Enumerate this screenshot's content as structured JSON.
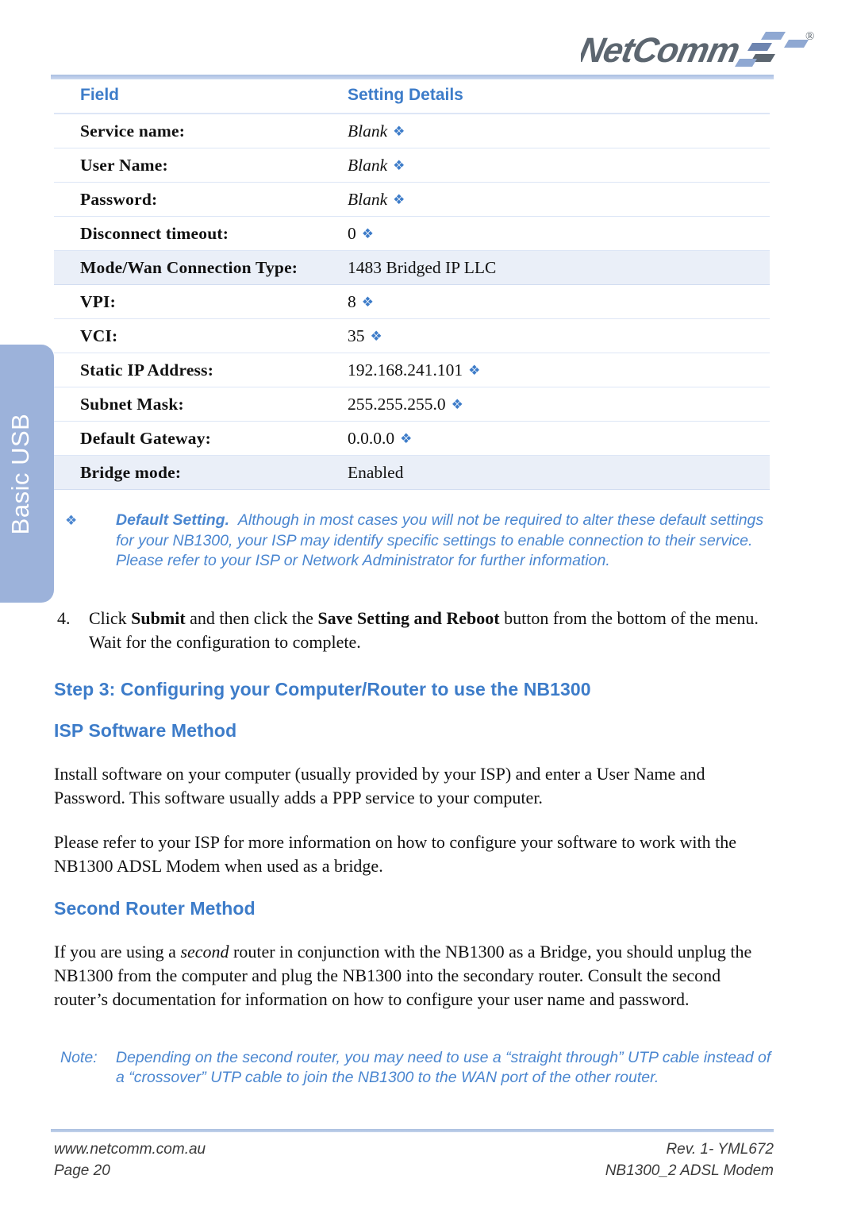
{
  "brand": {
    "logo_text": "NetComm",
    "registered_mark": "®"
  },
  "side_tab": {
    "label": "Basic USB"
  },
  "table": {
    "headers": {
      "field": "Field",
      "value": "Setting Details"
    },
    "rows": [
      {
        "field": "Service name:",
        "value": "Blank",
        "italic": true,
        "bullet": true,
        "shaded": false
      },
      {
        "field": "User Name:",
        "value": "Blank",
        "italic": true,
        "bullet": true,
        "shaded": false
      },
      {
        "field": "Password:",
        "value": "Blank",
        "italic": true,
        "bullet": true,
        "shaded": false
      },
      {
        "field": "Disconnect timeout:",
        "value": "0",
        "italic": false,
        "bullet": true,
        "shaded": false
      },
      {
        "field": "Mode/Wan Connection Type:",
        "value": "1483 Bridged IP LLC",
        "italic": false,
        "bullet": false,
        "shaded": true
      },
      {
        "field": "VPI:",
        "value": "8",
        "italic": false,
        "bullet": true,
        "shaded": false
      },
      {
        "field": "VCI:",
        "value": "35",
        "italic": false,
        "bullet": true,
        "shaded": false
      },
      {
        "field": "Static IP Address:",
        "value": "192.168.241.101",
        "italic": false,
        "bullet": true,
        "shaded": false
      },
      {
        "field": "Subnet Mask:",
        "value": "255.255.255.0",
        "italic": false,
        "bullet": true,
        "shaded": false
      },
      {
        "field": "Default Gateway:",
        "value": "0.0.0.0",
        "italic": false,
        "bullet": true,
        "shaded": false
      },
      {
        "field": "Bridge mode:",
        "value": "Enabled",
        "italic": false,
        "bullet": false,
        "shaded": true
      }
    ]
  },
  "default_setting_note": {
    "marker": "❖",
    "lead": "Default Setting.",
    "text": "Although in most cases you will not be required to alter these default settings for your NB1300, your ISP may identify specific settings to enable connection to their service.  Please refer to your ISP or Network Administrator for further information."
  },
  "step4": {
    "number": "4.",
    "part1": "Click ",
    "bold1": "Submit",
    "part2": " and then click the ",
    "bold2": "Save Setting and Reboot",
    "part3": " button from the bottom of the menu. Wait for the configuration to complete."
  },
  "headings": {
    "step3": "Step 3:  Configuring your Computer/Router to use the NB1300",
    "isp_software_method": "ISP Software Method",
    "second_router_method": "Second Router Method"
  },
  "paragraphs": {
    "isp_p1": "Install software on your computer (usually provided by your ISP) and enter a User Name and Password.  This software usually adds a PPP service to your computer.",
    "isp_p2": "Please refer to your ISP for more information on how to configure your software to work with the NB1300 ADSL Modem when used as a bridge.",
    "router_p1_a": "If you are using a ",
    "router_p1_italic": "second",
    "router_p1_b": " router in conjunction with the NB1300 as a Bridge, you should unplug the NB1300 from the computer and plug the NB1300 into the secondary router.  Consult the second router’s documentation for information on how to configure your user name and password."
  },
  "bottom_note": {
    "marker": "Note:",
    "text": "Depending on the second router, you may need to use a “straight through” UTP cable instead of a “crossover” UTP cable to join the NB1300 to the WAN port of the other router."
  },
  "footer": {
    "left_top": "www.netcomm.com.au",
    "left_bottom": "Page 20",
    "right_top": "Rev. 1- YML672",
    "right_bottom": "NB1300_2 ADSL Modem"
  },
  "colors": {
    "accent_blue": "#3d7cc9",
    "note_blue": "#4a86d0",
    "tab_blue": "#9cb2da",
    "row_shade": "#eaeff8",
    "rule": "#dde6f6"
  }
}
